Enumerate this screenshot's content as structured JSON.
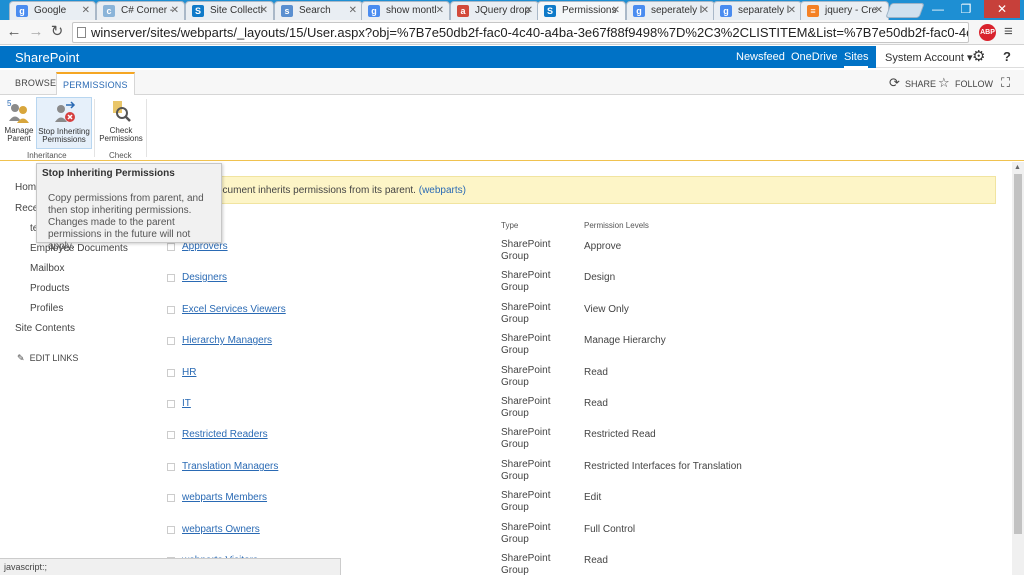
{
  "browser": {
    "tabs": [
      {
        "label": "Google",
        "favicon": "google-icon",
        "color": "#4a8cf0"
      },
      {
        "label": "C# Corner -",
        "favicon": "csharp-icon",
        "color": "#8ab4d9"
      },
      {
        "label": "Site Collecti",
        "favicon": "sharepoint-icon",
        "color": "#0f7ac9"
      },
      {
        "label": "Search",
        "favicon": "search-icon",
        "color": "#5a8fd0"
      },
      {
        "label": "show montl",
        "favicon": "google-icon",
        "color": "#4a8cf0"
      },
      {
        "label": "JQuery drop",
        "favicon": "as-icon",
        "color": "#d24a3a"
      },
      {
        "label": "Permissions",
        "favicon": "sharepoint-icon",
        "color": "#0f7ac9"
      },
      {
        "label": "seperately l",
        "favicon": "google-icon",
        "color": "#4a8cf0"
      },
      {
        "label": "separately l",
        "favicon": "google-icon",
        "color": "#4a8cf0"
      },
      {
        "label": "jquery - Cre",
        "favicon": "stackoverflow-icon",
        "color": "#f48024"
      }
    ],
    "url": "winserver/sites/webparts/_layouts/15/User.aspx?obj=%7B7e50db2f-fac0-4c40-a4ba-3e67f88f9498%7D%2C3%2CLISTITEM&List=%7B7e50db2f-fac0-4c40-a4ba-3e6",
    "abp_label": "ABP",
    "status_text": "javascript:;"
  },
  "suite": {
    "brand": "SharePoint",
    "links": [
      "Newsfeed",
      "OneDrive",
      "Sites"
    ],
    "active_link": "Sites",
    "account": "System Account",
    "account_caret": "▾"
  },
  "ribbon": {
    "tabs": [
      "BROWSE",
      "PERMISSIONS"
    ],
    "active_tab": "PERMISSIONS",
    "share_label": "SHARE",
    "follow_label": "FOLLOW",
    "buttons": [
      {
        "line1": "Manage",
        "line2": "Parent"
      },
      {
        "line1": "Stop Inheriting",
        "line2": "Permissions"
      },
      {
        "line1": "Check",
        "line2": "Permissions"
      }
    ],
    "groups": [
      "Inheritance",
      "Check"
    ]
  },
  "tooltip": {
    "title": "Stop Inheriting Permissions",
    "body": "Copy permissions from parent, and then stop inheriting permissions. Changes made to the parent permissions in the future will not apply."
  },
  "leftnav": {
    "items": [
      {
        "label": "Home",
        "visible": "Hom"
      },
      {
        "label": "Recent",
        "visible": "Rece"
      },
      {
        "label": "te",
        "visible": "te"
      },
      {
        "label": "Employee Documents",
        "visible": "Employee Documents"
      },
      {
        "label": "Mailbox",
        "visible": "Mailbox"
      },
      {
        "label": "Products",
        "visible": "Products"
      },
      {
        "label": "Profiles",
        "visible": "Profiles"
      },
      {
        "label": "Site Contents",
        "visible": "Site Contents"
      }
    ],
    "edit_links": "EDIT LINKS"
  },
  "info": {
    "text": "ocument inherits permissions from its parent.",
    "link": "(webparts)"
  },
  "table": {
    "headers": {
      "type": "Type",
      "levels": "Permission Levels"
    },
    "rows": [
      {
        "name": "Approvers",
        "type_line1": "SharePoint",
        "type_line2": "Group",
        "level": "Approve"
      },
      {
        "name": "Designers",
        "type_line1": "SharePoint",
        "type_line2": "Group",
        "level": "Design"
      },
      {
        "name": "Excel Services Viewers",
        "type_line1": "SharePoint",
        "type_line2": "Group",
        "level": "View Only"
      },
      {
        "name": "Hierarchy Managers",
        "type_line1": "SharePoint",
        "type_line2": "Group",
        "level": "Manage Hierarchy"
      },
      {
        "name": "HR",
        "type_line1": "SharePoint",
        "type_line2": "Group",
        "level": "Read"
      },
      {
        "name": "IT",
        "type_line1": "SharePoint",
        "type_line2": "Group",
        "level": "Read"
      },
      {
        "name": "Restricted Readers",
        "type_line1": "SharePoint",
        "type_line2": "Group",
        "level": "Restricted Read"
      },
      {
        "name": "Translation Managers",
        "type_line1": "SharePoint",
        "type_line2": "Group",
        "level": "Restricted Interfaces for Translation"
      },
      {
        "name": "webparts Members",
        "type_line1": "SharePoint",
        "type_line2": "Group",
        "level": "Edit"
      },
      {
        "name": "webparts Owners",
        "type_line1": "SharePoint",
        "type_line2": "Group",
        "level": "Full Control"
      },
      {
        "name": "webparts Visitors",
        "type_line1": "SharePoint",
        "type_line2": "Group",
        "level": "Read"
      }
    ]
  }
}
